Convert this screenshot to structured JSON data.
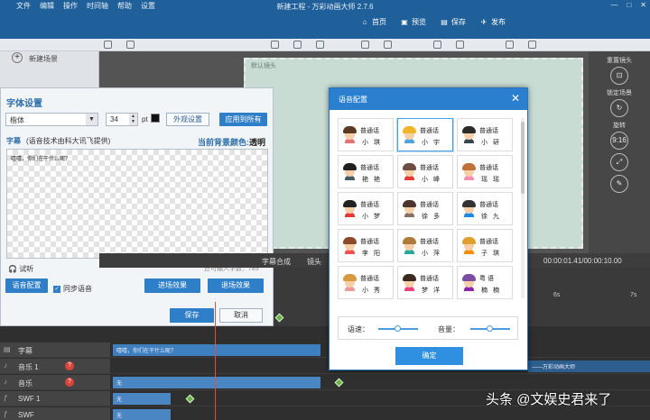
{
  "window": {
    "title": "新建工程 - 万彩动画大师 2.7.6",
    "menu": [
      "文件",
      "编辑",
      "操作",
      "时间轴",
      "帮助",
      "设置"
    ]
  },
  "nav": {
    "home": "首页",
    "preview": "预览",
    "save": "保存",
    "publish": "发布"
  },
  "scene": {
    "new_scene": "新建场景"
  },
  "canvas": {
    "default_camera": "默认镜头"
  },
  "right_panel": {
    "reset_camera": "重置镜头",
    "lock_scene": "锁定场景",
    "rotate": "旋转",
    "ratio": "9:16"
  },
  "font_dialog": {
    "title": "字体设置",
    "font": "楷体",
    "size": "34",
    "pt": "pt",
    "appearance_button": "外观设置",
    "apply_all_button": "应用到所有",
    "caption_label": "字幕",
    "caption_source": "(语音技术由科大讯飞提供)",
    "bg_color_label": "当前背景颜色:",
    "bg_color_value": "透明",
    "caption_text": "嘻嘻，你们在干什么呢？",
    "listen": "试听",
    "remaining": "还可输入字数：789",
    "voice_config_button": "语音配置",
    "sync_voice": "同步语音",
    "enter_effect_button": "进场效果",
    "exit_effect_button": "退场效果",
    "save_button": "保存",
    "cancel_button": "取消"
  },
  "voice_dialog": {
    "title": "语音配置",
    "voices": [
      {
        "type": "普通话",
        "name": "小 琪",
        "hair": "#5a3a22",
        "shirt": "#e57373",
        "selected": false
      },
      {
        "type": "普通话",
        "name": "小 宇",
        "hair": "#f0b429",
        "shirt": "#4fa3e0",
        "selected": true
      },
      {
        "type": "普通话",
        "name": "小 研",
        "hair": "#2b2b2b",
        "shirt": "#37474f",
        "selected": false
      },
      {
        "type": "普通话",
        "name": "艳 艳",
        "hair": "#1f1f1f",
        "shirt": "#455a64",
        "selected": false
      },
      {
        "type": "普通话",
        "name": "小 峰",
        "hair": "#6d4c41",
        "shirt": "#e53935",
        "selected": false
      },
      {
        "type": "普通话",
        "name": "瑶 瑶",
        "hair": "#c0703a",
        "shirt": "#f48fb1",
        "selected": false
      },
      {
        "type": "普通话",
        "name": "小 梦",
        "hair": "#222222",
        "shirt": "#e53935",
        "selected": false
      },
      {
        "type": "普通话",
        "name": "徐 多",
        "hair": "#4e342e",
        "shirt": "#8d6e63",
        "selected": false
      },
      {
        "type": "普通话",
        "name": "徐 九",
        "hair": "#333333",
        "shirt": "#1e88e5",
        "selected": false
      },
      {
        "type": "普通话",
        "name": "李 阳",
        "hair": "#8d4a2a",
        "shirt": "#ef5350",
        "selected": false
      },
      {
        "type": "普通话",
        "name": "小 萍",
        "hair": "#b07a3a",
        "shirt": "#26a69a",
        "selected": false
      },
      {
        "type": "普通话",
        "name": "子 琪",
        "hair": "#e0a030",
        "shirt": "#fb8c00",
        "selected": false
      },
      {
        "type": "普通话",
        "name": "小 秀",
        "hair": "#d89a40",
        "shirt": "#ef9a9a",
        "selected": false
      },
      {
        "type": "普通话",
        "name": "梦 洋",
        "hair": "#3a2a20",
        "shirt": "#ec407a",
        "selected": false
      },
      {
        "type": "粤 语",
        "name": "楠 楠",
        "hair": "#7b4ea3",
        "shirt": "#8e24aa",
        "selected": false
      }
    ],
    "speed_label": "语速：",
    "volume_label": "音量：",
    "speed": 0.5,
    "volume": 0.5,
    "ok_button": "确定"
  },
  "timeline": {
    "timecode": "00:00:01.41/00:00:10.00",
    "camera_label": "镜头",
    "caption_tab": "字幕合成",
    "ticks": [
      "6s",
      "7s"
    ],
    "tracks": [
      {
        "name": "字幕",
        "clip": "嘻嘻，你们在干什么呢？"
      },
      {
        "name": "音乐 1",
        "clip": "——万彩动画大师"
      },
      {
        "name": "音乐",
        "clip": "无"
      },
      {
        "name": "SWF 1",
        "clip": "无"
      },
      {
        "name": "SWF",
        "clip": "无"
      }
    ]
  },
  "watermark": "头条 @文娱史君来了"
}
